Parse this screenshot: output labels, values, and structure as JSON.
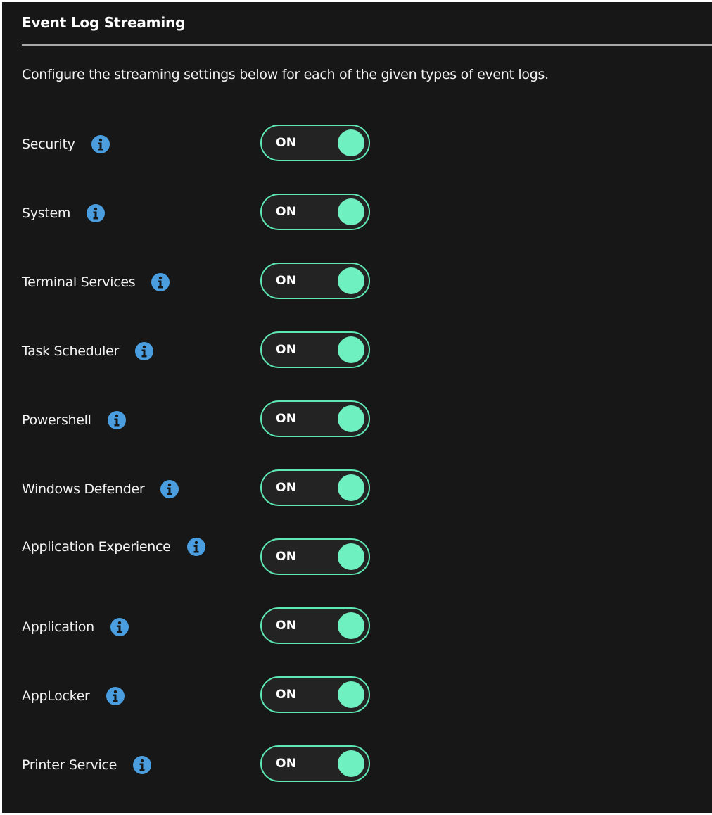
{
  "panel": {
    "title": "Event Log Streaming",
    "description": "Configure the streaming settings below for each of the given types of event logs."
  },
  "colors": {
    "background": "#171717",
    "accent": "#6ef0c0",
    "info_icon": "#4a9ee0",
    "text": "#f2f2f2"
  },
  "rows": [
    {
      "label": "Security",
      "icon": "info-icon",
      "toggle": {
        "state": "ON",
        "on": true
      }
    },
    {
      "label": "System",
      "icon": "info-icon",
      "toggle": {
        "state": "ON",
        "on": true
      }
    },
    {
      "label": "Terminal Services",
      "icon": "info-icon",
      "toggle": {
        "state": "ON",
        "on": true
      }
    },
    {
      "label": "Task Scheduler",
      "icon": "info-icon",
      "toggle": {
        "state": "ON",
        "on": true
      }
    },
    {
      "label": "Powershell",
      "icon": "info-icon",
      "toggle": {
        "state": "ON",
        "on": true
      }
    },
    {
      "label": "Windows Defender",
      "icon": "info-icon",
      "toggle": {
        "state": "ON",
        "on": true
      }
    },
    {
      "label": "Application Experience",
      "icon": "info-icon",
      "toggle": {
        "state": "ON",
        "on": true
      }
    },
    {
      "label": "Application",
      "icon": "info-icon",
      "toggle": {
        "state": "ON",
        "on": true
      }
    },
    {
      "label": "AppLocker",
      "icon": "info-icon",
      "toggle": {
        "state": "ON",
        "on": true
      }
    },
    {
      "label": "Printer Service",
      "icon": "info-icon",
      "toggle": {
        "state": "ON",
        "on": true
      }
    }
  ]
}
